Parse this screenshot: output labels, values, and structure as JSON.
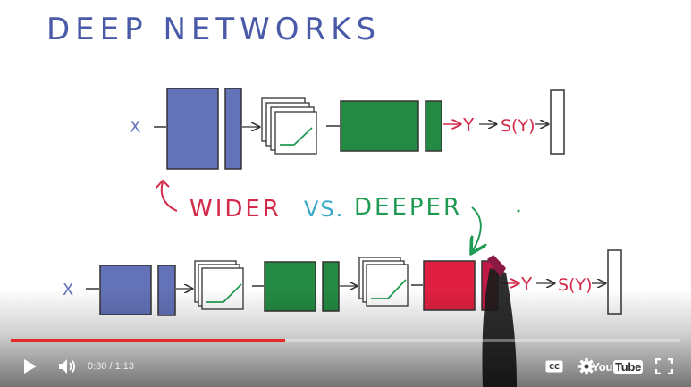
{
  "slide": {
    "title": "DEEP NETWORKS",
    "top_row": {
      "input": "X",
      "output": "Y",
      "softmax": "S(Y)"
    },
    "bottom_row": {
      "input": "X",
      "output": "Y",
      "softmax": "S(Y)"
    },
    "caption_wider": "WIDER",
    "caption_vs": "VS.",
    "caption_deeper": "DEEPER"
  },
  "colors": {
    "title_ink": "#4a5aa8",
    "blue_block": "#6472b8",
    "green_block": "#248a43",
    "red_block": "#e02040",
    "red_ink": "#d42a4a",
    "teal_ink": "#38a8c8",
    "green_ink": "#1f9a52",
    "progress_played": "#e1282a"
  },
  "player": {
    "current_time": "0:30",
    "separator": " / ",
    "duration": "1:13",
    "progress_fraction": 0.41,
    "logo_you": "You",
    "logo_tube": "Tube",
    "icons": [
      "play-icon",
      "volume-icon",
      "captions-icon",
      "settings-icon",
      "youtube-logo",
      "fullscreen-icon"
    ]
  }
}
